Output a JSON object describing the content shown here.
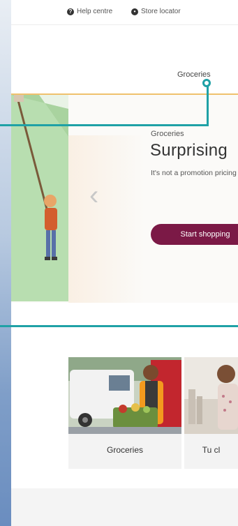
{
  "utility_nav": {
    "help_label": "Help centre",
    "store_label": "Store locator"
  },
  "main_nav": {
    "groceries_label": "Groceries"
  },
  "hero": {
    "eyebrow": "Groceries",
    "headline": "Surprising",
    "subtext": "It's not a promotion pricing",
    "cta_label": "Start shopping",
    "colors": {
      "cta": "#7b1946",
      "accent_line": "#efc16d",
      "art_background": "#b8deb0"
    }
  },
  "tiles": [
    {
      "label": "Groceries"
    },
    {
      "label": "Tu cl"
    }
  ],
  "annotation": {
    "color": "#1fa1a6"
  }
}
